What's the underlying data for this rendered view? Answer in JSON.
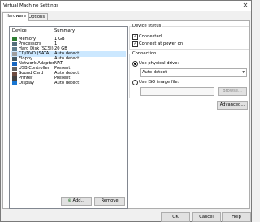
{
  "window": {
    "title": "Virtual Machine Settings",
    "close_glyph": "✕"
  },
  "tabs": [
    {
      "label": "Hardware"
    },
    {
      "label": "Options"
    }
  ],
  "device_list": {
    "headers": {
      "device": "Device",
      "summary": "Summary"
    },
    "rows": [
      {
        "name": "Memory",
        "summary": "1 GB",
        "icon": "memory-icon",
        "color": "#2e7d32"
      },
      {
        "name": "Processors",
        "summary": "1",
        "icon": "processor-icon",
        "color": "#546e7a"
      },
      {
        "name": "Hard Disk (SCSI)",
        "summary": "20 GB",
        "icon": "hard-disk-icon",
        "color": "#607d8b"
      },
      {
        "name": "CD/DVD (SATA)",
        "summary": "Auto detect",
        "icon": "cd-dvd-icon",
        "color": "#9e9e9e",
        "selected": true
      },
      {
        "name": "Floppy",
        "summary": "Auto detect",
        "icon": "floppy-icon",
        "color": "#455a64"
      },
      {
        "name": "Network Adapter",
        "summary": "NAT",
        "icon": "network-adapter-icon",
        "color": "#1565c0"
      },
      {
        "name": "USB Controller",
        "summary": "Present",
        "icon": "usb-icon",
        "color": "#616161"
      },
      {
        "name": "Sound Card",
        "summary": "Auto detect",
        "icon": "sound-card-icon",
        "color": "#6d4c41"
      },
      {
        "name": "Printer",
        "summary": "Present",
        "icon": "printer-icon",
        "color": "#424242"
      },
      {
        "name": "Display",
        "summary": "Auto detect",
        "icon": "display-icon",
        "color": "#1976d2"
      }
    ]
  },
  "list_buttons": {
    "add": "Add...",
    "remove": "Remove"
  },
  "device_status": {
    "title": "Device status",
    "connected": {
      "label": "Connected",
      "checked": true
    },
    "connect_at_power_on": {
      "label": "Connect at power on",
      "checked": true
    }
  },
  "connection": {
    "title": "Connection",
    "physical": {
      "label": "Use physical drive:",
      "selected": true
    },
    "physical_value": "Auto detect",
    "iso": {
      "label": "Use ISO image file:",
      "selected": false
    },
    "browse": "Browse...",
    "advanced": "Advanced..."
  },
  "footer": {
    "ok": "OK",
    "cancel": "Cancel",
    "help": "Help"
  }
}
